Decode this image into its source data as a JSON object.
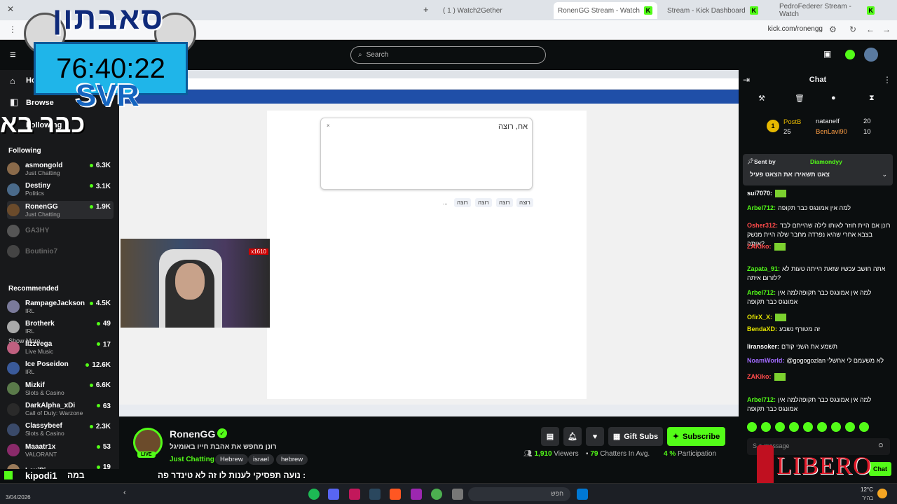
{
  "browser": {
    "tabs": [
      {
        "label": "( 1 ) Watch2Gether"
      },
      {
        "label": "RonenGG Stream - Watch"
      },
      {
        "label": "Stream - Kick Dashboard"
      },
      {
        "label": "PedroFederer Stream - Watch"
      }
    ],
    "url": "kick.com/ronengg"
  },
  "overlay": {
    "clock": "76:40:22",
    "logo_top": "סאבתון",
    "logo_svr": "SVR",
    "logo_bottom": "כבר בא"
  },
  "header": {
    "search_placeholder": "Search"
  },
  "sidebar": {
    "nav": [
      {
        "label": "Ho"
      },
      {
        "label": "Browse"
      },
      {
        "label": "Following"
      }
    ],
    "following_title": "Following",
    "following": [
      {
        "name": "asmongold",
        "sub": "Just Chatting",
        "count": "6.3K",
        "color": "#8a6a4a"
      },
      {
        "name": "Destiny",
        "sub": "Politics",
        "count": "3.1K",
        "color": "#4a6a8a"
      },
      {
        "name": "RonenGG",
        "sub": "Just Chatting",
        "count": "1.9K",
        "color": "#6b4b2b"
      },
      {
        "name": "GA3HY",
        "sub": "",
        "count": "",
        "color": "#555555"
      },
      {
        "name": "Boutinio7",
        "sub": "",
        "count": "",
        "color": "#444444"
      }
    ],
    "show_more": "Show More",
    "recommended_title": "Recommended",
    "recommended": [
      {
        "name": "RampageJackson",
        "sub": "IRL",
        "count": "4.5K",
        "color": "#7a7a9a"
      },
      {
        "name": "Brotherk",
        "sub": "IRL",
        "count": "49",
        "color": "#aaaaaa"
      },
      {
        "name": "lizzvega",
        "sub": "Live Music",
        "count": "17",
        "color": "#c06080"
      },
      {
        "name": "Ice Poseidon",
        "sub": "IRL",
        "count": "12.6K",
        "color": "#3a5a9a"
      },
      {
        "name": "Mizkif",
        "sub": "Slots & Casino",
        "count": "6.6K",
        "color": "#5a7a4a"
      },
      {
        "name": "DarkAlpha_xDi",
        "sub": "Call of Duty: Warzone",
        "count": "63",
        "color": "#2a2a2a"
      },
      {
        "name": "Classybeef",
        "sub": "Slots & Casino",
        "count": "2.3K",
        "color": "#3a4a6a"
      },
      {
        "name": "Maaatr1x",
        "sub": "VALORANT",
        "count": "53",
        "color": "#8a2a6a"
      },
      {
        "name": "LexiPi",
        "sub": "",
        "count": "19",
        "color": "#9a7a5a"
      }
    ]
  },
  "video": {
    "textbox": "אח, רוצה",
    "chips": [
      "רוצה",
      "רוצה",
      "רוצה",
      "רוצה",
      "..."
    ],
    "webcam_overlay": "x1610"
  },
  "stream": {
    "name": "RonenGG",
    "title": "רונן מחפש את אהבת חייו באומיגל",
    "category": "Just Chatting",
    "tags": [
      "Hebrew",
      "israel",
      "hebrew"
    ],
    "live": "LIVE",
    "gift_subs": "Gift Subs",
    "subscribe": "Subscribe",
    "viewers": "1,910",
    "viewers_label": "Viewers",
    "chatters": "79",
    "chatters_label": "Chatters In Avg.",
    "participation": "4 %",
    "participation_label": "Participation"
  },
  "chat": {
    "title": "Chat",
    "top_gifters": [
      {
        "name": "PostB",
        "count": "25"
      },
      {
        "name": "natanelf",
        "count": "20"
      },
      {
        "name": "BenLavi90",
        "count": "10"
      }
    ],
    "pinned_by": "Sent by",
    "pinned_user": "Diamondyy",
    "pinned_text": "צאט תשאירו את הצאט פעיל",
    "messages": [
      {
        "user": "sui7070:",
        "text": "",
        "color": "#ffffff"
      },
      {
        "user": "Arbel712:",
        "text": "למה אין אמונגס כבר תקופה",
        "color": "#53fc18"
      },
      {
        "user": "Osher312:",
        "text": "רונן אם היית חוזר לאותו לילה שהייתם לבד בצבא אחרי שהיא נפרדה מחבר שלה היית מנשק אותה?",
        "color": "#ff4b4b"
      },
      {
        "user": "ZAKiko:",
        "text": "",
        "color": "#ff4b4b"
      },
      {
        "user": "Zapata_91:",
        "text": "אתה חושב עכשיו שזאת הייתה טעות לא לזרום איתה?",
        "color": "#53fc18"
      },
      {
        "user": "Arbel712:",
        "text": "למה אין אמונגס כבר תקופהלמה אין אמונגס כבר תקופה",
        "color": "#53fc18"
      },
      {
        "user": "OfirX_X:",
        "text": "",
        "color": "#e6e600"
      },
      {
        "user": "BendaXD:",
        "text": "זה מטורף נשבע",
        "color": "#e6e600"
      },
      {
        "user": "liransoker:",
        "text": "תשמע את השני קודם",
        "color": "#ffffff"
      },
      {
        "user": "NoamWorld:",
        "text": "@gogogozlan לא משעמם לי אחשלי",
        "color": "#a16bff"
      },
      {
        "user": "ZAKiko:",
        "text": "",
        "color": "#ff4b4b"
      },
      {
        "user": "Arbel712:",
        "text": "למה אין אמונגס כבר תקופהלמה אין אמונגס כבר תקופה",
        "color": "#53fc18"
      }
    ],
    "input_placeholder": "S    a message",
    "send": "Chat",
    "ad": "LIBERO"
  },
  "ticker": {
    "text": "נועה תפסיקי לענות לו זה לא טינדר פה :",
    "user": "kipodi1",
    "user_suffix": "במה"
  },
  "taskbar": {
    "search": "חפש",
    "temp": "12°C",
    "city": "בהיר",
    "date": "3/04/2026"
  },
  "colors": {
    "kick_green": "#53fc18",
    "bg": "#0b0e0f"
  }
}
